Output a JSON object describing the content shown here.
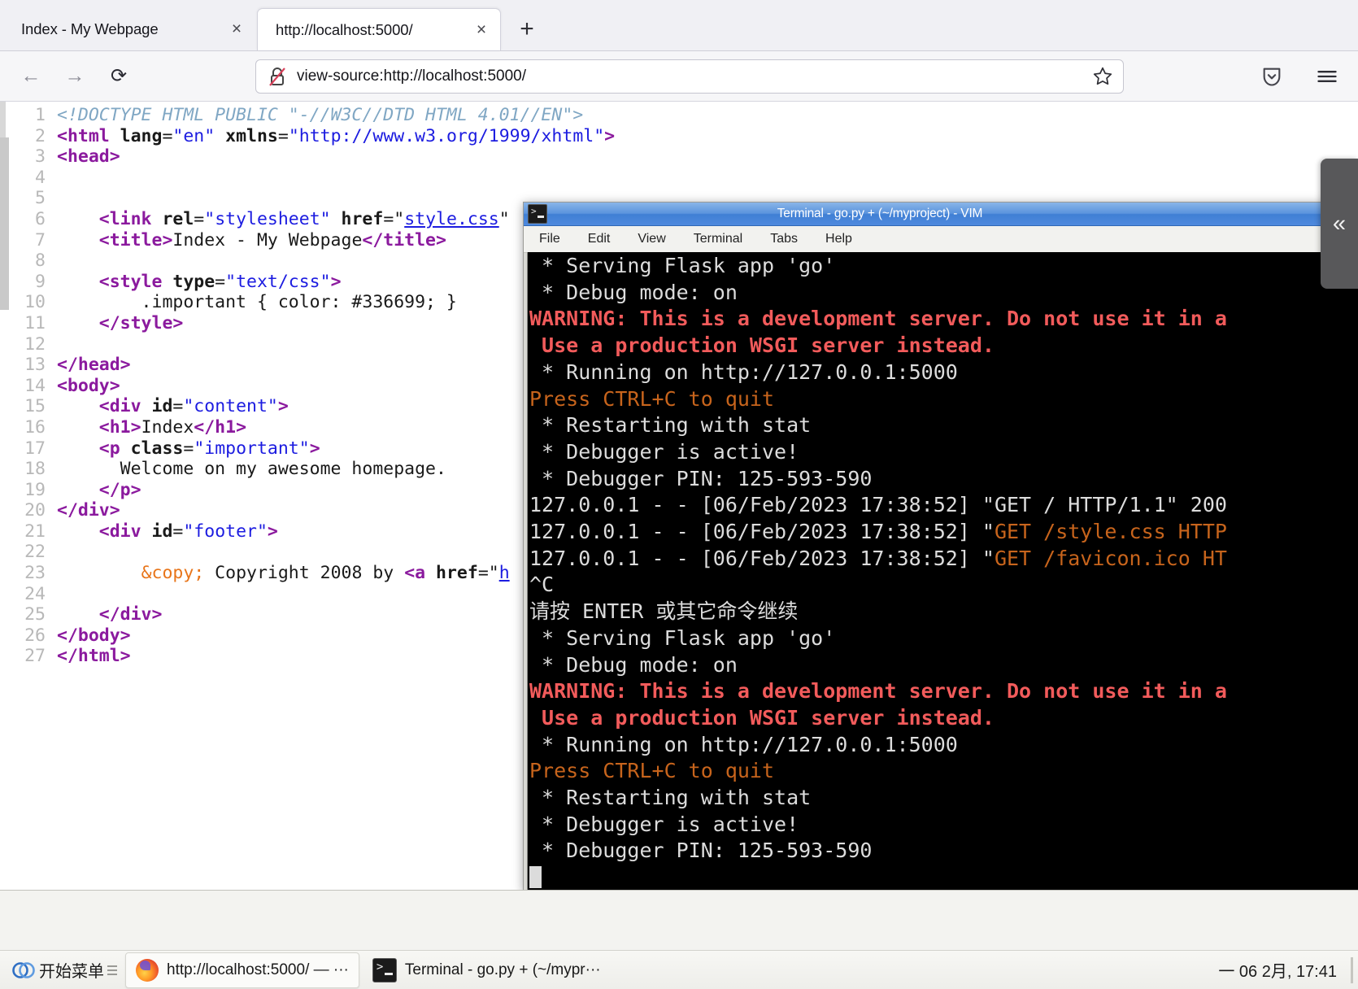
{
  "browser": {
    "tabs": [
      {
        "title": "Index - My Webpage",
        "active": false,
        "close": "×"
      },
      {
        "title": "http://localhost:5000/",
        "active": true,
        "close": "×"
      }
    ],
    "new_tab_label": "+",
    "nav": {
      "back": "←",
      "forward": "→",
      "reload": "⟳",
      "url": "view-source:http://localhost:5000/",
      "lock_icon": "broken-lock-icon",
      "star_icon": "star-outline-icon",
      "pocket_icon": "pocket-shield-icon",
      "menu_icon": "hamburger-menu-icon"
    }
  },
  "source_view": {
    "lines": [
      {
        "n": "1",
        "tokens": [
          {
            "t": "doctype",
            "s": "<!DOCTYPE HTML PUBLIC \"-//W3C//DTD HTML 4.01//EN\">"
          }
        ]
      },
      {
        "n": "2",
        "tokens": [
          {
            "t": "tag",
            "s": "<html "
          },
          {
            "t": "attr",
            "s": "lang"
          },
          {
            "t": "txt",
            "s": "="
          },
          {
            "t": "val",
            "s": "\"en\""
          },
          {
            "t": "txt",
            "s": " "
          },
          {
            "t": "attr",
            "s": "xmlns"
          },
          {
            "t": "txt",
            "s": "="
          },
          {
            "t": "val",
            "s": "\"http://www.w3.org/1999/xhtml\""
          },
          {
            "t": "tag",
            "s": ">"
          }
        ]
      },
      {
        "n": "3",
        "tokens": [
          {
            "t": "tag",
            "s": "<head>"
          }
        ]
      },
      {
        "n": "4",
        "tokens": []
      },
      {
        "n": "5",
        "tokens": []
      },
      {
        "n": "6",
        "tokens": [
          {
            "t": "txt",
            "s": "    "
          },
          {
            "t": "tag",
            "s": "<link "
          },
          {
            "t": "attr",
            "s": "rel"
          },
          {
            "t": "txt",
            "s": "="
          },
          {
            "t": "val",
            "s": "\"stylesheet\""
          },
          {
            "t": "txt",
            "s": " "
          },
          {
            "t": "attr",
            "s": "href"
          },
          {
            "t": "txt",
            "s": "=\""
          },
          {
            "t": "link",
            "s": "style.css"
          },
          {
            "t": "txt",
            "s": "\""
          }
        ]
      },
      {
        "n": "7",
        "tokens": [
          {
            "t": "txt",
            "s": "    "
          },
          {
            "t": "tag",
            "s": "<title>"
          },
          {
            "t": "txt",
            "s": "Index - My Webpage"
          },
          {
            "t": "tag",
            "s": "</title>"
          }
        ]
      },
      {
        "n": "8",
        "tokens": []
      },
      {
        "n": "9",
        "tokens": [
          {
            "t": "txt",
            "s": "    "
          },
          {
            "t": "tag",
            "s": "<style "
          },
          {
            "t": "attr",
            "s": "type"
          },
          {
            "t": "txt",
            "s": "="
          },
          {
            "t": "val",
            "s": "\"text/css\""
          },
          {
            "t": "tag",
            "s": ">"
          }
        ]
      },
      {
        "n": "10",
        "tokens": [
          {
            "t": "txt",
            "s": "        .important { color: #336699; }"
          }
        ]
      },
      {
        "n": "11",
        "tokens": [
          {
            "t": "txt",
            "s": "    "
          },
          {
            "t": "tag",
            "s": "</style>"
          }
        ]
      },
      {
        "n": "12",
        "tokens": []
      },
      {
        "n": "13",
        "tokens": [
          {
            "t": "tag",
            "s": "</head>"
          }
        ]
      },
      {
        "n": "14",
        "tokens": [
          {
            "t": "tag",
            "s": "<body>"
          }
        ]
      },
      {
        "n": "15",
        "tokens": [
          {
            "t": "txt",
            "s": "    "
          },
          {
            "t": "tag",
            "s": "<div "
          },
          {
            "t": "attr",
            "s": "id"
          },
          {
            "t": "txt",
            "s": "="
          },
          {
            "t": "val",
            "s": "\"content\""
          },
          {
            "t": "tag",
            "s": ">"
          }
        ]
      },
      {
        "n": "16",
        "tokens": [
          {
            "t": "txt",
            "s": "    "
          },
          {
            "t": "tag",
            "s": "<h1>"
          },
          {
            "t": "txt",
            "s": "Index"
          },
          {
            "t": "tag",
            "s": "</h1>"
          }
        ]
      },
      {
        "n": "17",
        "tokens": [
          {
            "t": "txt",
            "s": "    "
          },
          {
            "t": "tag",
            "s": "<p "
          },
          {
            "t": "attr",
            "s": "class"
          },
          {
            "t": "txt",
            "s": "="
          },
          {
            "t": "val",
            "s": "\"important\""
          },
          {
            "t": "tag",
            "s": ">"
          }
        ]
      },
      {
        "n": "18",
        "tokens": [
          {
            "t": "txt",
            "s": "      Welcome on my awesome homepage."
          }
        ]
      },
      {
        "n": "19",
        "tokens": [
          {
            "t": "txt",
            "s": "    "
          },
          {
            "t": "tag",
            "s": "</p>"
          }
        ]
      },
      {
        "n": "20",
        "tokens": [
          {
            "t": "tag",
            "s": "</div>"
          }
        ]
      },
      {
        "n": "21",
        "tokens": [
          {
            "t": "txt",
            "s": "    "
          },
          {
            "t": "tag",
            "s": "<div "
          },
          {
            "t": "attr",
            "s": "id"
          },
          {
            "t": "txt",
            "s": "="
          },
          {
            "t": "val",
            "s": "\"footer\""
          },
          {
            "t": "tag",
            "s": ">"
          }
        ]
      },
      {
        "n": "22",
        "tokens": []
      },
      {
        "n": "23",
        "tokens": [
          {
            "t": "txt",
            "s": "        "
          },
          {
            "t": "ent",
            "s": "&copy;"
          },
          {
            "t": "txt",
            "s": " Copyright 2008 by "
          },
          {
            "t": "tag",
            "s": "<a "
          },
          {
            "t": "attr",
            "s": "href"
          },
          {
            "t": "txt",
            "s": "=\""
          },
          {
            "t": "link",
            "s": "h"
          }
        ]
      },
      {
        "n": "24",
        "tokens": []
      },
      {
        "n": "25",
        "tokens": [
          {
            "t": "txt",
            "s": "    "
          },
          {
            "t": "tag",
            "s": "</div>"
          }
        ]
      },
      {
        "n": "26",
        "tokens": [
          {
            "t": "tag",
            "s": "</body>"
          }
        ]
      },
      {
        "n": "27",
        "tokens": [
          {
            "t": "tag",
            "s": "</html>"
          }
        ]
      }
    ]
  },
  "pulltab": {
    "icon": "chevron-double-left-icon",
    "glyph": "«"
  },
  "terminal": {
    "title": "Terminal - go.py + (~/myproject) - VIM",
    "icon": "terminal-icon",
    "menu": [
      "File",
      "Edit",
      "View",
      "Terminal",
      "Tabs",
      "Help"
    ],
    "lines": [
      {
        "parts": [
          {
            "c": "white",
            "s": " * Serving Flask app 'go'"
          }
        ]
      },
      {
        "parts": [
          {
            "c": "white",
            "s": " * Debug mode: on"
          }
        ]
      },
      {
        "parts": [
          {
            "c": "red",
            "s": "WARNING: This is a development server. Do not use it in a"
          }
        ]
      },
      {
        "parts": [
          {
            "c": "red",
            "s": " Use a production WSGI server instead."
          }
        ]
      },
      {
        "parts": [
          {
            "c": "white",
            "s": " * Running on http://127.0.0.1:5000"
          }
        ]
      },
      {
        "parts": [
          {
            "c": "orange",
            "s": "Press CTRL+C to quit"
          }
        ]
      },
      {
        "parts": [
          {
            "c": "white",
            "s": " * Restarting with stat"
          }
        ]
      },
      {
        "parts": [
          {
            "c": "white",
            "s": " * Debugger is active!"
          }
        ]
      },
      {
        "parts": [
          {
            "c": "white",
            "s": " * Debugger PIN: 125-593-590"
          }
        ]
      },
      {
        "parts": [
          {
            "c": "white",
            "s": "127.0.0.1 - - [06/Feb/2023 17:38:52] \"GET / HTTP/1.1\" 200"
          }
        ]
      },
      {
        "parts": [
          {
            "c": "white",
            "s": "127.0.0.1 - - [06/Feb/2023 17:38:52] \""
          },
          {
            "c": "orange",
            "s": "GET /style.css HTTP"
          }
        ]
      },
      {
        "parts": [
          {
            "c": "white",
            "s": "127.0.0.1 - - [06/Feb/2023 17:38:52] \""
          },
          {
            "c": "orange",
            "s": "GET /favicon.ico HT"
          }
        ]
      },
      {
        "parts": [
          {
            "c": "white",
            "s": "^C"
          }
        ]
      },
      {
        "parts": [
          {
            "c": "white",
            "s": "请按 ENTER 或其它命令继续"
          }
        ]
      },
      {
        "parts": [
          {
            "c": "white",
            "s": " * Serving Flask app 'go'"
          }
        ]
      },
      {
        "parts": [
          {
            "c": "white",
            "s": " * Debug mode: on"
          }
        ]
      },
      {
        "parts": [
          {
            "c": "red",
            "s": "WARNING: This is a development server. Do not use it in a"
          }
        ]
      },
      {
        "parts": [
          {
            "c": "red",
            "s": " Use a production WSGI server instead."
          }
        ]
      },
      {
        "parts": [
          {
            "c": "white",
            "s": " * Running on http://127.0.0.1:5000"
          }
        ]
      },
      {
        "parts": [
          {
            "c": "orange",
            "s": "Press CTRL+C to quit"
          }
        ]
      },
      {
        "parts": [
          {
            "c": "white",
            "s": " * Restarting with stat"
          }
        ]
      },
      {
        "parts": [
          {
            "c": "white",
            "s": " * Debugger is active!"
          }
        ]
      },
      {
        "parts": [
          {
            "c": "white",
            "s": " * Debugger PIN: 125-593-590"
          }
        ]
      },
      {
        "parts": [
          {
            "c": "cursor",
            "s": ""
          }
        ]
      }
    ]
  },
  "taskbar": {
    "start_label": "开始菜单",
    "start_icon": "start-menu-logo",
    "tasks": [
      {
        "label": "http://localhost:5000/ — ···",
        "icon": "firefox-icon",
        "active": true
      },
      {
        "label": "Terminal - go.py + (~/mypr···",
        "icon": "terminal-icon",
        "active": false
      }
    ],
    "clock": "一 06 2月, 17:41"
  },
  "colors": {
    "accent_blue": "#3f7fd4",
    "terminal_bg": "#000000",
    "warn_red": "#f25b5b",
    "log_orange": "#c7641c",
    "tag_purple": "#8b1a9e",
    "value_blue": "#1c1ce0"
  }
}
